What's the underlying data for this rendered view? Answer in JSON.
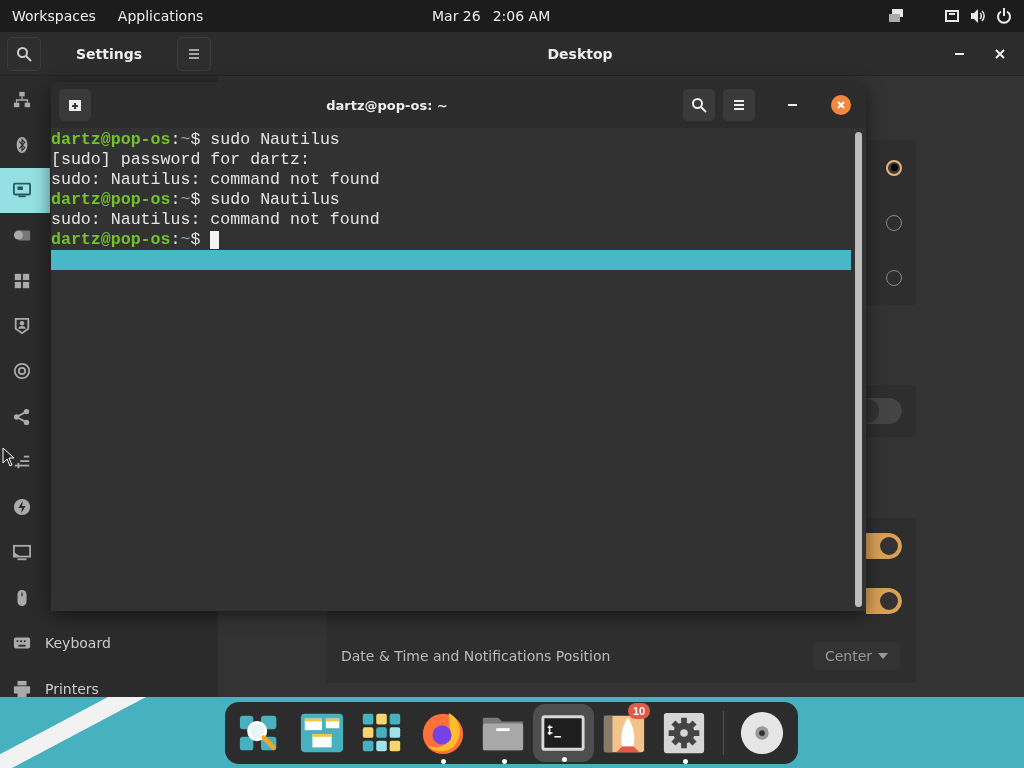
{
  "top_bar": {
    "workspaces": "Workspaces",
    "applications": "Applications",
    "date": "Mar 26",
    "time": "2:06 AM"
  },
  "settings_window": {
    "title": "Settings",
    "page_title": "Desktop",
    "sidebar": {
      "items": [
        {
          "selected": false
        },
        {
          "selected": false
        },
        {
          "selected": true
        },
        {
          "selected": false
        },
        {
          "selected": false
        },
        {
          "selected": false
        },
        {
          "selected": false
        },
        {
          "selected": false
        },
        {
          "selected": false
        },
        {
          "selected": false
        },
        {
          "selected": false
        },
        {
          "selected": false
        },
        {
          "label": "Keyboard",
          "selected": false
        },
        {
          "label": "Printers",
          "selected": false
        }
      ]
    },
    "radios": [
      {
        "selected": true
      },
      {
        "selected": false
      },
      {
        "selected": false
      }
    ],
    "switch": {
      "on": false
    },
    "toggles": [
      {
        "on": true
      },
      {
        "on": true
      }
    ],
    "position_row": {
      "label": "Date & Time and Notifications Position",
      "value": "Center"
    }
  },
  "terminal_window": {
    "title": "dartz@pop-os: ~",
    "lines": [
      {
        "kind": "prompt",
        "host": "dartz@pop-os",
        "separator": ":",
        "path": "~",
        "symbol": "$",
        "command": " sudo Nautilus"
      },
      {
        "kind": "output",
        "text": "[sudo] password for dartz:"
      },
      {
        "kind": "output",
        "text": "sudo: Nautilus: command not found"
      },
      {
        "kind": "prompt",
        "host": "dartz@pop-os",
        "separator": ":",
        "path": "~",
        "symbol": "$",
        "command": " sudo Nautilus"
      },
      {
        "kind": "output",
        "text": "sudo: Nautilus: command not found"
      },
      {
        "kind": "prompt",
        "host": "dartz@pop-os",
        "separator": ":",
        "path": "~",
        "symbol": "$",
        "cursor": true
      }
    ]
  },
  "dock": {
    "items": [
      {
        "running": false,
        "active": false
      },
      {
        "running": false,
        "active": false
      },
      {
        "running": false,
        "active": false
      },
      {
        "running": true,
        "active": false
      },
      {
        "running": true,
        "active": false
      },
      {
        "running": true,
        "active": true
      },
      {
        "running": false,
        "active": false,
        "badge": "10"
      },
      {
        "running": true,
        "active": false
      },
      {
        "running": false,
        "active": false
      }
    ]
  }
}
